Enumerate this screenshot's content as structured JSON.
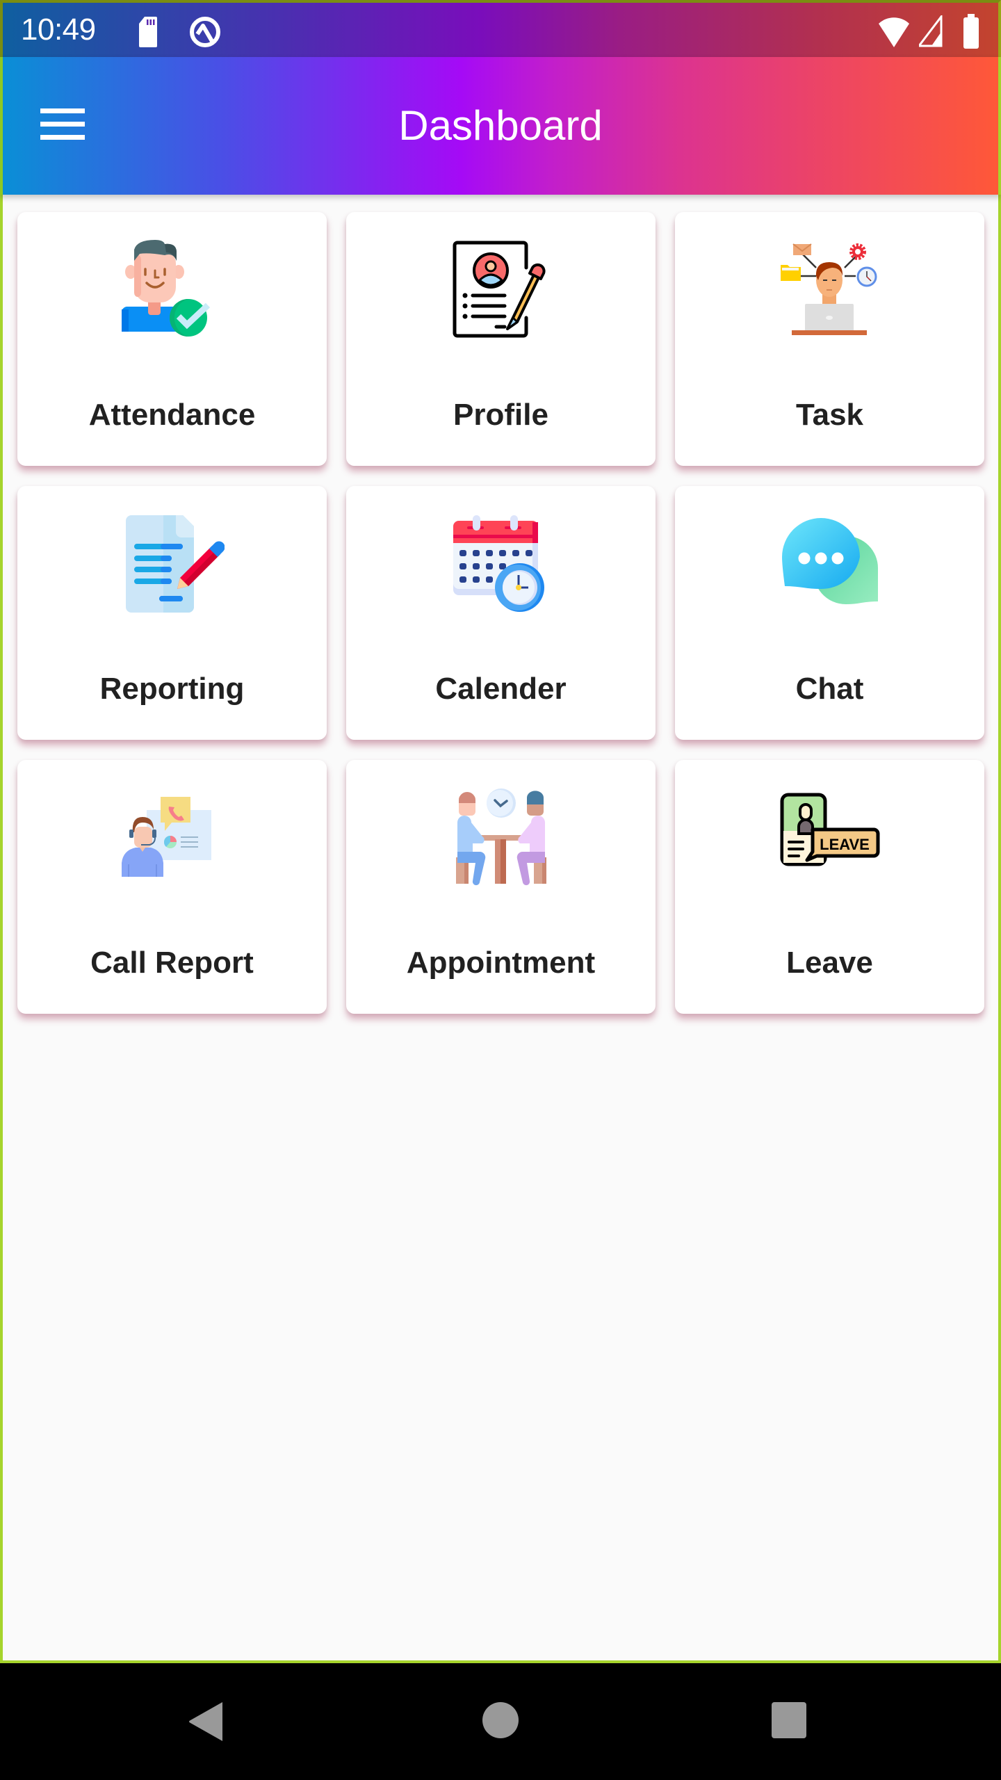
{
  "status_bar": {
    "time": "10:49",
    "icons": [
      "sd-card-icon",
      "q-notification-icon",
      "wifi-icon",
      "cellular-signal-icon",
      "battery-icon"
    ]
  },
  "app_bar": {
    "title": "Dashboard",
    "menu_icon": "hamburger-menu-icon",
    "gradient_colors": [
      "#0a8fd6",
      "#a50af6",
      "#dc3390",
      "#ff5838"
    ]
  },
  "dashboard": {
    "tiles": [
      {
        "label": "Attendance",
        "icon": "attendance-icon"
      },
      {
        "label": "Profile",
        "icon": "profile-icon"
      },
      {
        "label": "Task",
        "icon": "task-icon"
      },
      {
        "label": "Reporting",
        "icon": "reporting-icon"
      },
      {
        "label": "Calender",
        "icon": "calendar-icon"
      },
      {
        "label": "Chat",
        "icon": "chat-icon"
      },
      {
        "label": "Call Report",
        "icon": "call-report-icon"
      },
      {
        "label": "Appointment",
        "icon": "appointment-icon"
      },
      {
        "label": "Leave",
        "icon": "leave-icon"
      }
    ],
    "leave_badge_text": "LEAVE"
  },
  "nav_bar": {
    "buttons": [
      "back",
      "home",
      "recents"
    ]
  }
}
